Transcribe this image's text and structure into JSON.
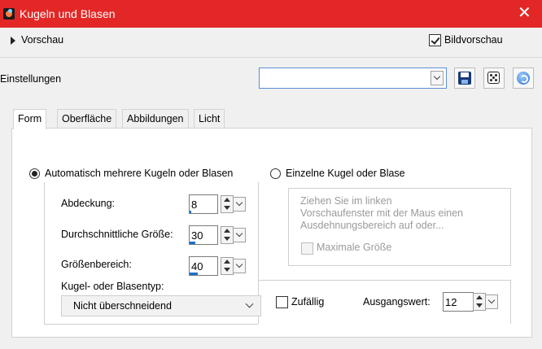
{
  "window": {
    "title": "Kugeln und Blasen",
    "close_glyph": "✕",
    "app_icon": "balls-bubbles-app-icon",
    "title_color": "#e32727"
  },
  "preview": {
    "expander_label": "Vorschau",
    "show_preview_label": "Bildvorschau",
    "show_preview_checked": true
  },
  "settings": {
    "label": "Einstellungen",
    "preset_value": "",
    "icons": [
      "save-icon",
      "randomize-dice-icon",
      "reset-icon"
    ]
  },
  "tabs": [
    {
      "label": "Form",
      "active": true
    },
    {
      "label": "Oberfläche",
      "active": false
    },
    {
      "label": "Abbildungen",
      "active": false
    },
    {
      "label": "Licht",
      "active": false
    }
  ],
  "form": {
    "mode_auto_label": "Automatisch mehrere Kugeln oder Blasen",
    "mode_auto_selected": true,
    "mode_single_label": "Einzelne Kugel oder Blase",
    "mode_single_selected": false,
    "coverage": {
      "label": "Abdeckung:",
      "value": "8",
      "level_percent": 8
    },
    "avg_size": {
      "label": "Durchschnittliche Größe:",
      "value": "30",
      "level_percent": 30
    },
    "size_range": {
      "label": "Größenbereich:",
      "value": "40",
      "level_percent": 40
    },
    "type_label": "Kugel- oder Blasentyp:",
    "type_value": "Nicht überschneidend",
    "single_hint": "Ziehen Sie im linken\nVorschaufenster mit der Maus einen\nAusdehnungsbereich auf oder...",
    "single_hint_line1": "Ziehen Sie im linken",
    "single_hint_line2": "Vorschaufenster mit der Maus einen",
    "single_hint_line3": "Ausdehnungsbereich auf oder...",
    "max_size_label": "Maximale Größe",
    "max_size_checked": false,
    "random_label": "Zufällig",
    "random_checked": false,
    "seed_label": "Ausgangswert:",
    "seed_value": "12"
  },
  "colors": {
    "accent": "#1a6fd0",
    "background": "#f0f0f0",
    "panel": "#ffffff"
  }
}
